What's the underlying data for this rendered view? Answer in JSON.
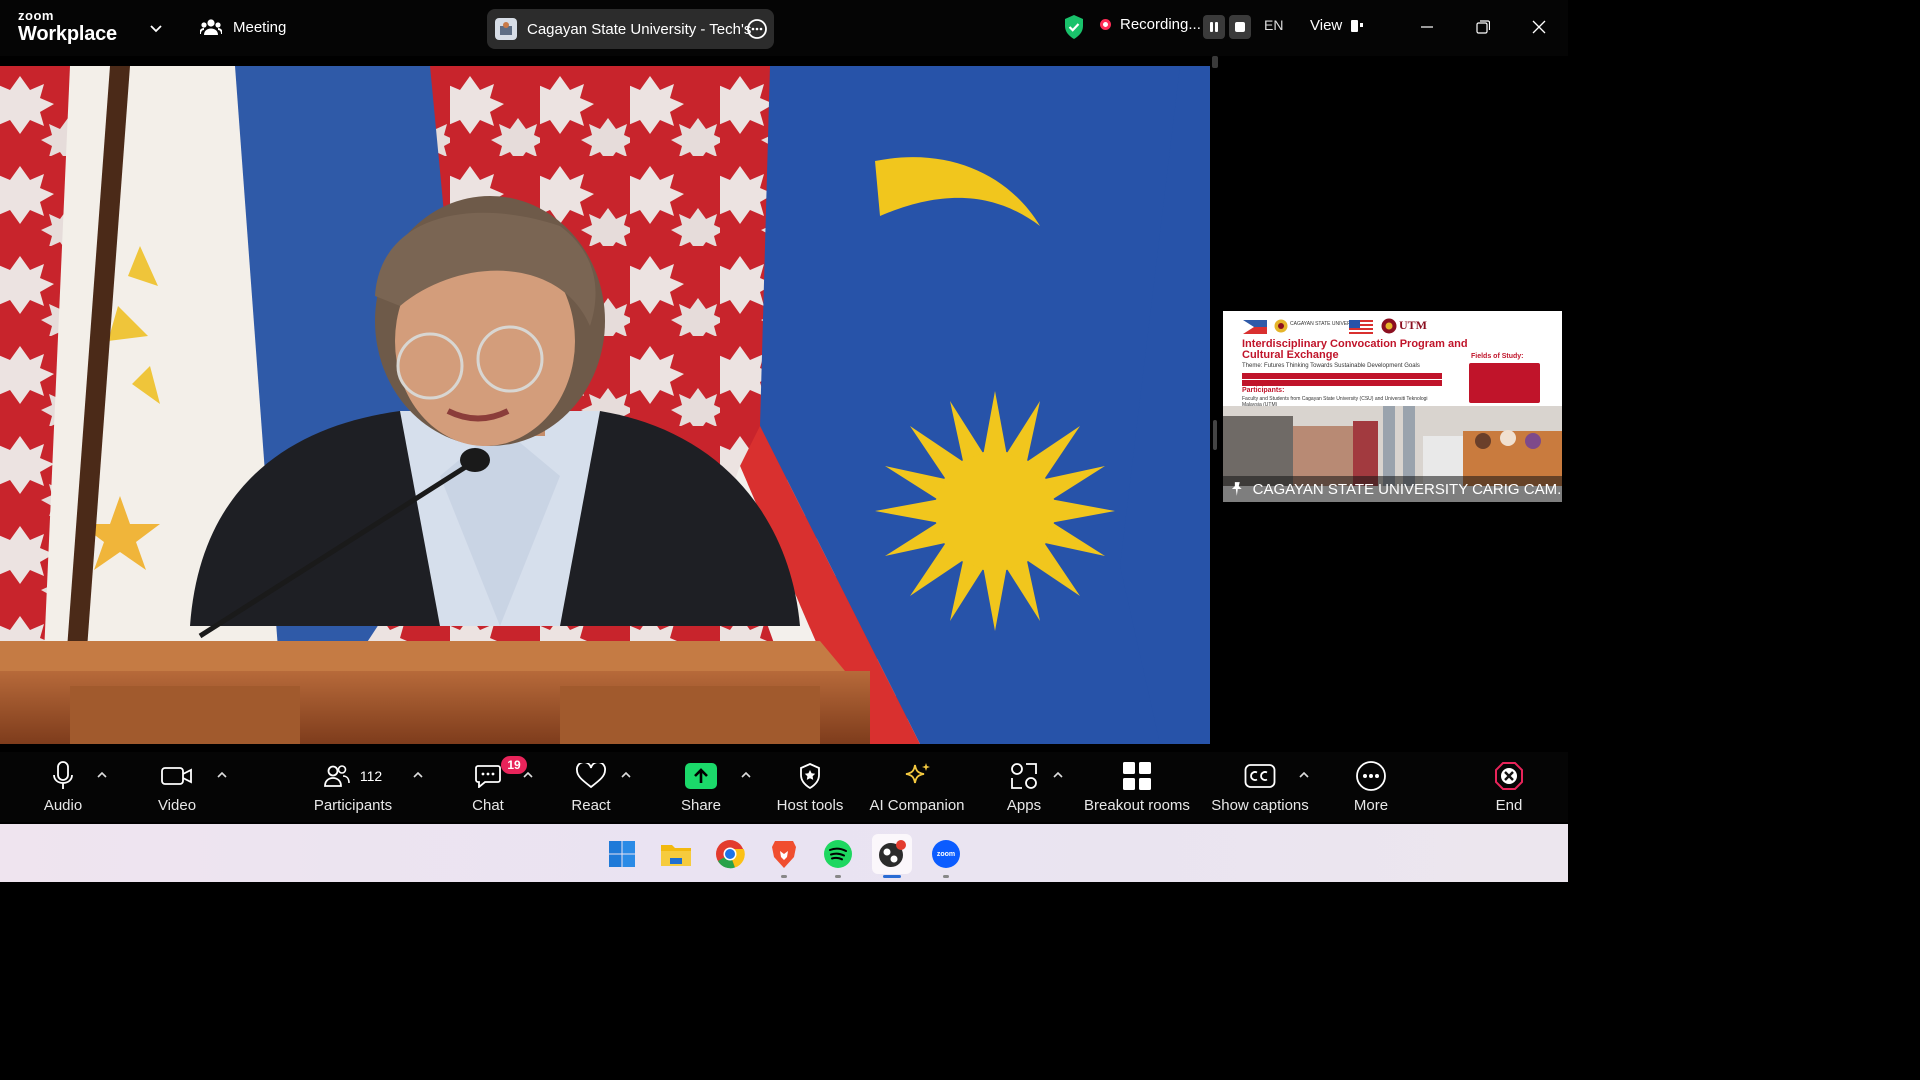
{
  "titlebar": {
    "brand_top": "zoom",
    "brand_bottom": "Workplace",
    "meeting_label": "Meeting",
    "meeting_title": "Cagayan State University - Tech's",
    "recording_label": "Recording...",
    "language": "EN",
    "view_label": "View"
  },
  "thumbnail": {
    "participant_name": "CAGAYAN STATE UNIVERSITY CARIG CAM...",
    "poster_title": "Interdisciplinary Convocation Program and Cultural Exchange",
    "poster_theme": "Theme: Futures Thinking Towards Sustainable Development Goals",
    "poster_participants_heading": "Participants:",
    "poster_participants_text": "Faculty and Students from Cagayan State University (CSU) and Universiti Teknologi Malaysia (UTM)",
    "poster_fields_heading": "Fields of Study:",
    "poster_utm": "UTM",
    "poster_csu": "CAGAYAN STATE UNIVERSITY"
  },
  "toolbar": {
    "audio": "Audio",
    "video": "Video",
    "participants": "Participants",
    "participants_count": "112",
    "chat": "Chat",
    "chat_badge": "19",
    "react": "React",
    "share": "Share",
    "host_tools": "Host tools",
    "ai_companion": "AI Companion",
    "apps": "Apps",
    "breakout_rooms": "Breakout rooms",
    "show_captions": "Show captions",
    "more": "More",
    "end": "End"
  },
  "taskbar": {
    "zoom_icon_text": "zoom"
  },
  "colors": {
    "share_green": "#1bd96a",
    "end_red": "#e8245a",
    "badge_red": "#e8245a",
    "shield_green": "#19c26b",
    "record_red": "#ff2c55"
  }
}
